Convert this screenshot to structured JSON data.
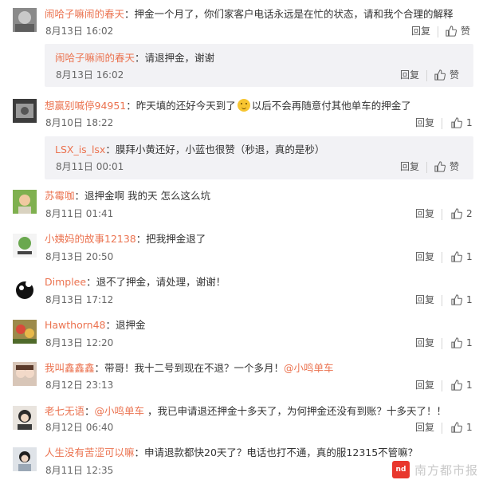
{
  "labels": {
    "reply": "回复",
    "like": "赞"
  },
  "comments": [
    {
      "user": "闹哈子嘛闹的春天",
      "text": "：押金一个月了，你们家客户电话永远是在忙的状态，请和我个合理的解释",
      "date": "8月13日 16:02",
      "likes": "赞",
      "reply": {
        "user": "闹哈子嘛闹的春天",
        "text": "：请退押金，谢谢",
        "date": "8月13日 16:02",
        "likes": "赞"
      }
    },
    {
      "user": "想赢别喊停94951",
      "text_before": "：昨天填的还好今天到了",
      "text_after": "以后不会再随意付其他单车的押金了",
      "date": "8月10日 18:22",
      "likes": "1",
      "reply": {
        "user": "LSX_is_lsx",
        "text": "：膜拜小黄还好，小蓝也很赞（秒退，真的是秒）",
        "date": "8月11日 00:01",
        "likes": "赞"
      }
    },
    {
      "user": "苏霉咖",
      "text": "：退押金啊 我的天 怎么这么坑",
      "date": "8月11日 01:41",
      "likes": "2"
    },
    {
      "user": "小姨妈的故事12138",
      "text": "：把我押金退了",
      "date": "8月13日 20:50",
      "likes": "1"
    },
    {
      "user": "Dimplee",
      "text": "：退不了押金，请处理，谢谢！",
      "date": "8月13日 17:12",
      "likes": "1"
    },
    {
      "user": "Hawthorn48",
      "text": "：退押金",
      "date": "8月13日 12:20",
      "likes": "1"
    },
    {
      "user": "我叫鑫鑫鑫",
      "text": "：带哥！我十二号到现在不退？一个多月！",
      "mention": "@小鸣单车",
      "date": "8月12日 23:13",
      "likes": "1"
    },
    {
      "user": "老七无语",
      "text_before": "：",
      "mention": "@小鸣单车",
      "text_after": " ，我已申请退还押金十多天了，为何押金还没有到账？十多天了！！",
      "date": "8月12日 06:40",
      "likes": "1"
    },
    {
      "user": "人生没有苦涩可以嘛",
      "text": "：申请退款都快20天了？电话也打不通，真的服12315不管嘛？",
      "date": "8月11日 12:35",
      "likes": ""
    }
  ],
  "watermark": {
    "logo": "nd",
    "text": "南方都市报"
  },
  "colors": {
    "username": "#eb7350",
    "subreply_bg": "#f2f2f5",
    "meta": "#555555"
  },
  "icons": {
    "like": "thumbs-up-icon"
  }
}
